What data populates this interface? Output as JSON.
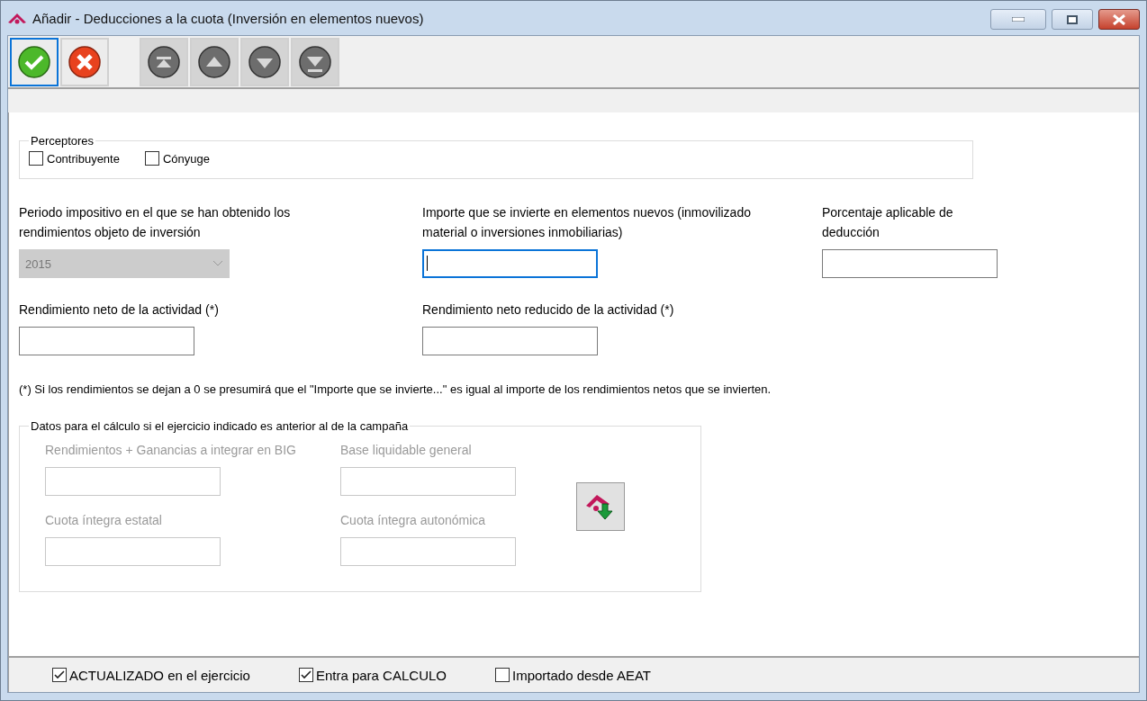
{
  "window": {
    "title": "Añadir  - Deducciones a la cuota (Inversión en elementos nuevos)"
  },
  "toolbar": {
    "buttons": [
      {
        "kind": "accept",
        "focused": true
      },
      {
        "kind": "cancel",
        "focused": false
      },
      {
        "kind": "first",
        "focused": false
      },
      {
        "kind": "previous",
        "focused": false
      },
      {
        "kind": "next",
        "focused": false
      },
      {
        "kind": "last",
        "focused": false
      }
    ]
  },
  "perceptores": {
    "legend": "Perceptores",
    "options": [
      {
        "label": "Contribuyente",
        "checked": false
      },
      {
        "label": "Cónyuge",
        "checked": false
      }
    ]
  },
  "fields": [
    {
      "kind": "select",
      "label": "Periodo impositivo en el que se han obtenido los rendimientos objeto de inversión",
      "value": "2015",
      "disabled": true
    },
    {
      "kind": "text",
      "label": "Importe que se invierte en elementos nuevos (inmovilizado material o inversiones inmobiliarias)",
      "disabled": false,
      "focused": true
    },
    {
      "kind": "text",
      "label": "Porcentaje aplicable de deducción",
      "disabled": false,
      "focused": false
    },
    {
      "kind": "text",
      "label": "Rendimiento neto de la actividad (*)",
      "disabled": false,
      "focused": false
    },
    {
      "kind": "text",
      "label": "Rendimiento neto reducido de la actividad (*)",
      "disabled": false,
      "focused": false
    }
  ],
  "note": "(*) Si los rendimientos se dejan a 0 se presumirá que el \"Importe que se invierte...\" es igual al importe de los rendimientos netos que se invierten.",
  "calculo": {
    "legend": "Datos para el cálculo si el ejercicio indicado es anterior al de la campaña",
    "disabled": true,
    "fields": [
      {
        "label": "Rendimientos + Ganancias a integrar en BIG"
      },
      {
        "label": "Base liquidable general"
      },
      {
        "label": "Cuota íntegra estatal"
      },
      {
        "label": "Cuota íntegra autonómica"
      }
    ]
  },
  "footer": [
    {
      "label": "ACTUALIZADO en el ejercicio",
      "checked": true
    },
    {
      "label": "Entra para CALCULO",
      "checked": true
    },
    {
      "label": "Importado desde AEAT",
      "checked": false
    }
  ]
}
